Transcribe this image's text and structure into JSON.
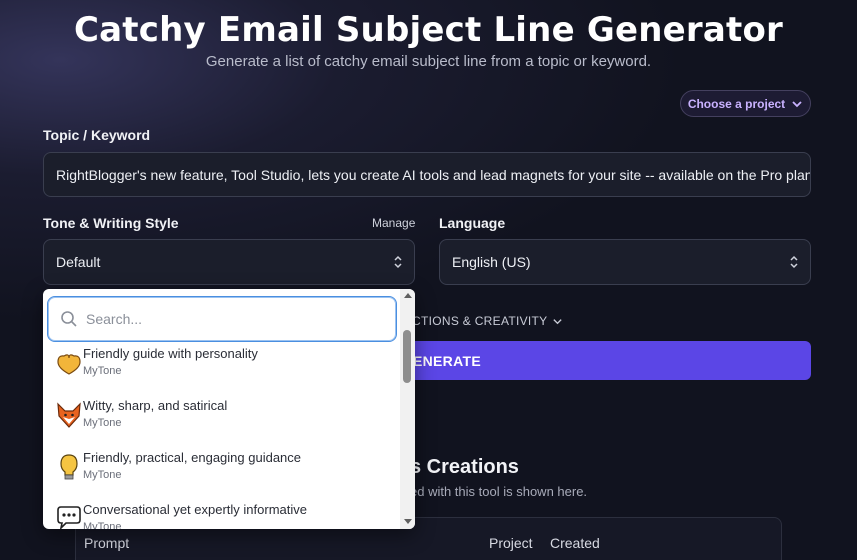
{
  "header": {
    "title": "Catchy Email Subject Line Generator",
    "subtitle": "Generate a list of catchy email subject line from a topic or keyword."
  },
  "project": {
    "label": "Choose a project",
    "icon": "chevron-down-icon"
  },
  "topic": {
    "label": "Topic / Keyword",
    "value": "RightBlogger's new feature, Tool Studio, lets you create AI tools and lead magnets for your site -- available on the Pro plan"
  },
  "tone": {
    "label": "Tone & Writing Style",
    "manage": "Manage",
    "value": "Default"
  },
  "language": {
    "label": "Language",
    "value": "English (US)"
  },
  "dropdown": {
    "search_placeholder": "Search...",
    "options": [
      {
        "name": "Friendly guide with personality",
        "source": "MyTone",
        "icon": "heart-hands-icon"
      },
      {
        "name": "Witty, sharp, and satirical",
        "source": "MyTone",
        "icon": "fox-icon"
      },
      {
        "name": "Friendly, practical, engaging guidance",
        "source": "MyTone",
        "icon": "lightbulb-icon"
      },
      {
        "name": "Conversational yet expertly informative",
        "source": "MyTone",
        "icon": "speech-bubble-icon"
      }
    ]
  },
  "instructions": {
    "label": "CTIONS & CREATIVITY"
  },
  "generate": {
    "label": "ENERATE"
  },
  "creations": {
    "title": "s Creations",
    "subtitle": "ed with this tool is shown here."
  },
  "table": {
    "columns": [
      "Prompt",
      "Project",
      "Created"
    ]
  },
  "colors": {
    "accent": "#5b46e6",
    "project_text": "#c9b2ff",
    "background": "#11131f"
  }
}
